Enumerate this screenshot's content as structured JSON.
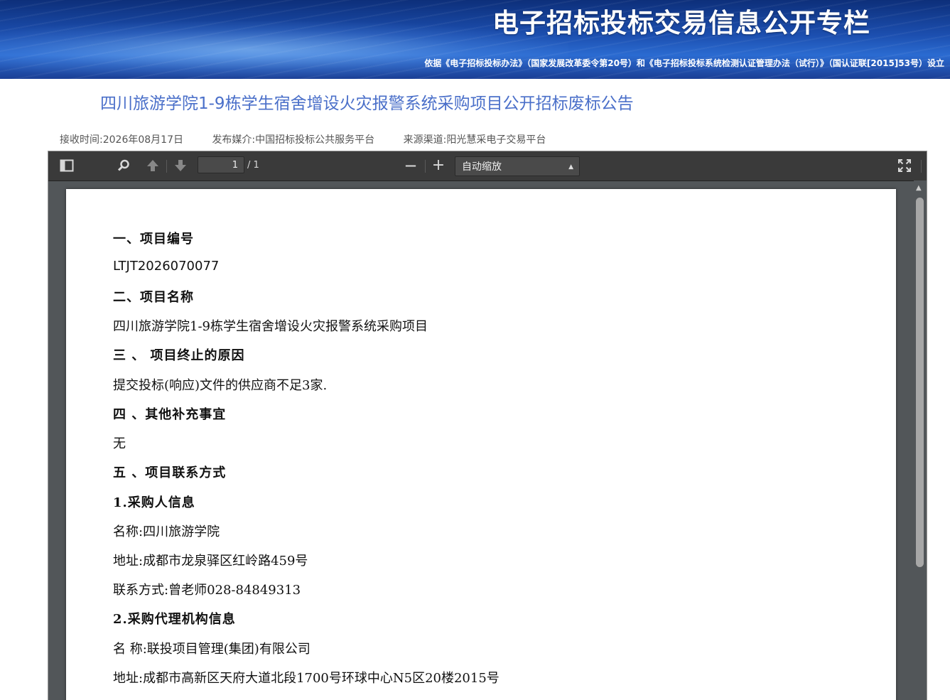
{
  "banner": {
    "title": "电子招标投标交易信息公开专栏",
    "subtitle": "依据《电子招标投标办法》（国家发展改革委令第20号）和《电子招标投标系统检测认证管理办法（试行）》（国认证联[2015]53号）设立"
  },
  "notice": {
    "title": "四川旅游学院1-9栋学生宿舍增设火灾报警系统采购项目公开招标废标公告",
    "received": "接收时间:2026年08月17日",
    "media": "发布媒介:中国招标投标公共服务平台",
    "source": "来源渠道:阳光慧采电子交易平台"
  },
  "viewer": {
    "page_current": "1",
    "page_total": "/ 1",
    "zoom": "自动缩放",
    "zoom_out": "—",
    "zoom_in": "+"
  },
  "doc": {
    "h1": "一、项目编号",
    "project_no": "LTJT2026070077",
    "h2": "二、项目名称",
    "project_name": "四川旅游学院1-9栋学生宿舍增设火灾报警系统采购项目",
    "h3": "三 、 项目终止的原因",
    "reason": "提交投标(响应)文件的供应商不足3家.",
    "h4": "四 、其他补充事宜",
    "other": "无",
    "h5": "五 、项目联系方式",
    "purchaser_head": "1.采购人信息",
    "purchaser_name": "名称:四川旅游学院",
    "purchaser_addr": "地址:成都市龙泉驿区红岭路459号",
    "purchaser_contact": "联系方式:曾老师028-84849313",
    "agency_head": "2.采购代理机构信息",
    "agency_name": "名 称:联投项目管理(集团)有限公司",
    "agency_addr": "地址:成都市高新区天府大道北段1700号环球中心N5区20楼2015号"
  }
}
